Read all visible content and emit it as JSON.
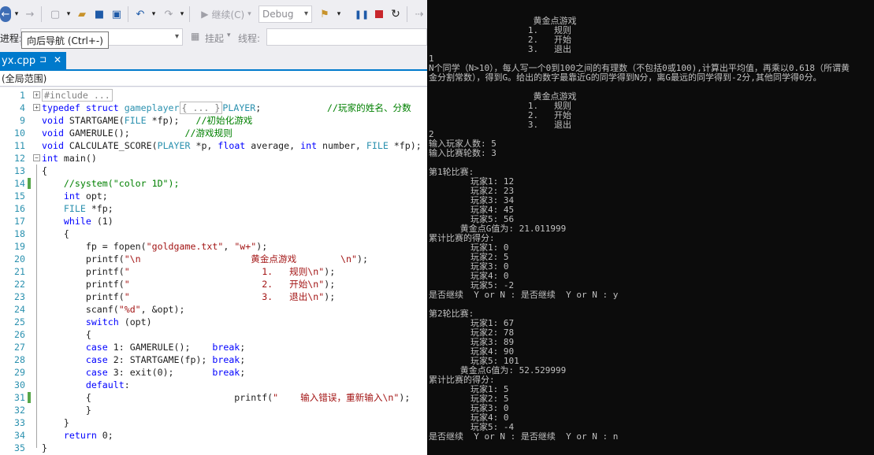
{
  "toolbar": {
    "continue_label": "继续(C)",
    "config_value": "Debug",
    "process_label": "进程:",
    "lifecycle_label": "挂起",
    "thread_label": "线程:",
    "tooltip": "向后导航 (Ctrl+-)"
  },
  "tab": {
    "filename": "yx.cpp",
    "pin": "⊐",
    "close": "✕"
  },
  "scope": "(全局范围)",
  "code": [
    {
      "n": "1",
      "fold": "+",
      "tokens": [
        {
          "c": "boxed",
          "t": "#include ..."
        }
      ]
    },
    {
      "n": "4",
      "fold": "+",
      "tokens": [
        {
          "c": "kw",
          "t": "typedef struct "
        },
        {
          "c": "ty",
          "t": "gameplayer"
        },
        {
          "c": "boxed",
          "t": "{ ... }"
        },
        {
          "c": "ty",
          "t": "PLAYER"
        },
        {
          "c": "",
          "t": ";            "
        },
        {
          "c": "cm",
          "t": "//玩家的姓名、分数"
        }
      ]
    },
    {
      "n": "9",
      "tokens": [
        {
          "c": "kw",
          "t": "void "
        },
        {
          "c": "",
          "t": "STARTGAME("
        },
        {
          "c": "ty",
          "t": "FILE"
        },
        {
          "c": "",
          "t": " *fp);   "
        },
        {
          "c": "cm",
          "t": "//初始化游戏"
        }
      ]
    },
    {
      "n": "10",
      "tokens": [
        {
          "c": "kw",
          "t": "void "
        },
        {
          "c": "",
          "t": "GAMERULE();          "
        },
        {
          "c": "cm",
          "t": "//游戏规则"
        }
      ]
    },
    {
      "n": "11",
      "tokens": [
        {
          "c": "kw",
          "t": "void "
        },
        {
          "c": "",
          "t": "CALCULATE_SCORE("
        },
        {
          "c": "ty",
          "t": "PLAYER"
        },
        {
          "c": "",
          "t": " *p, "
        },
        {
          "c": "kw",
          "t": "float "
        },
        {
          "c": "",
          "t": "average, "
        },
        {
          "c": "kw",
          "t": "int "
        },
        {
          "c": "",
          "t": "number, "
        },
        {
          "c": "ty",
          "t": "FILE"
        },
        {
          "c": "",
          "t": " *fp);"
        }
      ]
    },
    {
      "n": "12",
      "fold": "-",
      "tokens": [
        {
          "c": "kw",
          "t": "int "
        },
        {
          "c": "",
          "t": "main()"
        }
      ]
    },
    {
      "n": "13",
      "tokens": [
        {
          "c": "",
          "t": "{"
        }
      ]
    },
    {
      "n": "14",
      "chg": true,
      "tokens": [
        {
          "c": "",
          "t": "    "
        },
        {
          "c": "cm",
          "t": "//system(\"color 1D\");"
        }
      ]
    },
    {
      "n": "15",
      "tokens": [
        {
          "c": "",
          "t": "    "
        },
        {
          "c": "kw",
          "t": "int "
        },
        {
          "c": "",
          "t": "opt;"
        }
      ]
    },
    {
      "n": "16",
      "tokens": [
        {
          "c": "",
          "t": "    "
        },
        {
          "c": "ty",
          "t": "FILE"
        },
        {
          "c": "",
          "t": " *fp;"
        }
      ]
    },
    {
      "n": "17",
      "tokens": [
        {
          "c": "",
          "t": "    "
        },
        {
          "c": "kw",
          "t": "while "
        },
        {
          "c": "",
          "t": "(1)"
        }
      ]
    },
    {
      "n": "18",
      "tokens": [
        {
          "c": "",
          "t": "    {"
        }
      ]
    },
    {
      "n": "19",
      "tokens": [
        {
          "c": "",
          "t": "        fp = fopen("
        },
        {
          "c": "st",
          "t": "\"goldgame.txt\""
        },
        {
          "c": "",
          "t": ", "
        },
        {
          "c": "st",
          "t": "\"w+\""
        },
        {
          "c": "",
          "t": ");"
        }
      ]
    },
    {
      "n": "20",
      "tokens": [
        {
          "c": "",
          "t": "        printf("
        },
        {
          "c": "st",
          "t": "\"\\n                    黄金点游戏        \\n\""
        },
        {
          "c": "",
          "t": ");"
        }
      ]
    },
    {
      "n": "21",
      "tokens": [
        {
          "c": "",
          "t": "        printf("
        },
        {
          "c": "st",
          "t": "\"                        1.   规则\\n\""
        },
        {
          "c": "",
          "t": ");"
        }
      ]
    },
    {
      "n": "22",
      "tokens": [
        {
          "c": "",
          "t": "        printf("
        },
        {
          "c": "st",
          "t": "\"                        2.   开始\\n\""
        },
        {
          "c": "",
          "t": ");"
        }
      ]
    },
    {
      "n": "23",
      "tokens": [
        {
          "c": "",
          "t": "        printf("
        },
        {
          "c": "st",
          "t": "\"                        3.   退出\\n\""
        },
        {
          "c": "",
          "t": ");"
        }
      ]
    },
    {
      "n": "24",
      "tokens": [
        {
          "c": "",
          "t": "        scanf("
        },
        {
          "c": "st",
          "t": "\"%d\""
        },
        {
          "c": "",
          "t": ", &opt);"
        }
      ]
    },
    {
      "n": "25",
      "tokens": [
        {
          "c": "",
          "t": "        "
        },
        {
          "c": "kw",
          "t": "switch "
        },
        {
          "c": "",
          "t": "(opt)"
        }
      ]
    },
    {
      "n": "26",
      "tokens": [
        {
          "c": "",
          "t": "        {"
        }
      ]
    },
    {
      "n": "27",
      "tokens": [
        {
          "c": "",
          "t": "        "
        },
        {
          "c": "kw",
          "t": "case "
        },
        {
          "c": "",
          "t": "1: GAMERULE();    "
        },
        {
          "c": "kw",
          "t": "break"
        },
        {
          "c": "",
          "t": ";"
        }
      ]
    },
    {
      "n": "28",
      "tokens": [
        {
          "c": "",
          "t": "        "
        },
        {
          "c": "kw",
          "t": "case "
        },
        {
          "c": "",
          "t": "2: STARTGAME(fp); "
        },
        {
          "c": "kw",
          "t": "break"
        },
        {
          "c": "",
          "t": ";"
        }
      ]
    },
    {
      "n": "29",
      "tokens": [
        {
          "c": "",
          "t": "        "
        },
        {
          "c": "kw",
          "t": "case "
        },
        {
          "c": "",
          "t": "3: exit(0);       "
        },
        {
          "c": "kw",
          "t": "break"
        },
        {
          "c": "",
          "t": ";"
        }
      ]
    },
    {
      "n": "30",
      "tokens": [
        {
          "c": "",
          "t": "        "
        },
        {
          "c": "kw",
          "t": "default"
        },
        {
          "c": "",
          "t": ":"
        }
      ]
    },
    {
      "n": "31",
      "chg": true,
      "tokens": [
        {
          "c": "",
          "t": "        {                          printf("
        },
        {
          "c": "st",
          "t": "\"    输入错误，重新输入\\n\""
        },
        {
          "c": "",
          "t": ");"
        }
      ]
    },
    {
      "n": "32",
      "tokens": [
        {
          "c": "",
          "t": "        }"
        }
      ]
    },
    {
      "n": "33",
      "tokens": [
        {
          "c": "",
          "t": "    }"
        }
      ]
    },
    {
      "n": "34",
      "tokens": [
        {
          "c": "",
          "t": "    "
        },
        {
          "c": "kw",
          "t": "return "
        },
        {
          "c": "",
          "t": "0;"
        }
      ]
    },
    {
      "n": "35",
      "tokens": [
        {
          "c": "",
          "t": "}"
        }
      ]
    }
  ],
  "console_lines": [
    "                    黄金点游戏",
    "                   1.   规则",
    "                   2.   开始",
    "                   3.   退出",
    "1",
    "N个同学（N>10），每人写一个0到100之间的有理数（不包括0或100),计算出平均值，再乘以0.618（所谓黄",
    "金分割常数），得到G。给出的数字最靠近G的同学得到N分，离G最远的同学得到-2分,其他同学得0分。",
    "",
    "                    黄金点游戏",
    "                   1.   规则",
    "                   2.   开始",
    "                   3.   退出",
    "2",
    "输入玩家人数: 5",
    "输入比赛轮数: 3",
    "",
    "第1轮比赛:",
    "        玩家1: 12",
    "        玩家2: 23",
    "        玩家3: 34",
    "        玩家4: 45",
    "        玩家5: 56",
    "      黄金点G值为: 21.011999",
    "累计比赛的得分:",
    "        玩家1: 0",
    "        玩家2: 5",
    "        玩家3: 0",
    "        玩家4: 0",
    "        玩家5: -2",
    "是否继续  Y or N : 是否继续  Y or N : y",
    "",
    "第2轮比赛:",
    "        玩家1: 67",
    "        玩家2: 78",
    "        玩家3: 89",
    "        玩家4: 90",
    "        玩家5: 101",
    "      黄金点G值为: 52.529999",
    "累计比赛的得分:",
    "        玩家1: 5",
    "        玩家2: 5",
    "        玩家3: 0",
    "        玩家4: 0",
    "        玩家5: -4",
    "是否继续  Y or N : 是否继续  Y or N : n"
  ]
}
